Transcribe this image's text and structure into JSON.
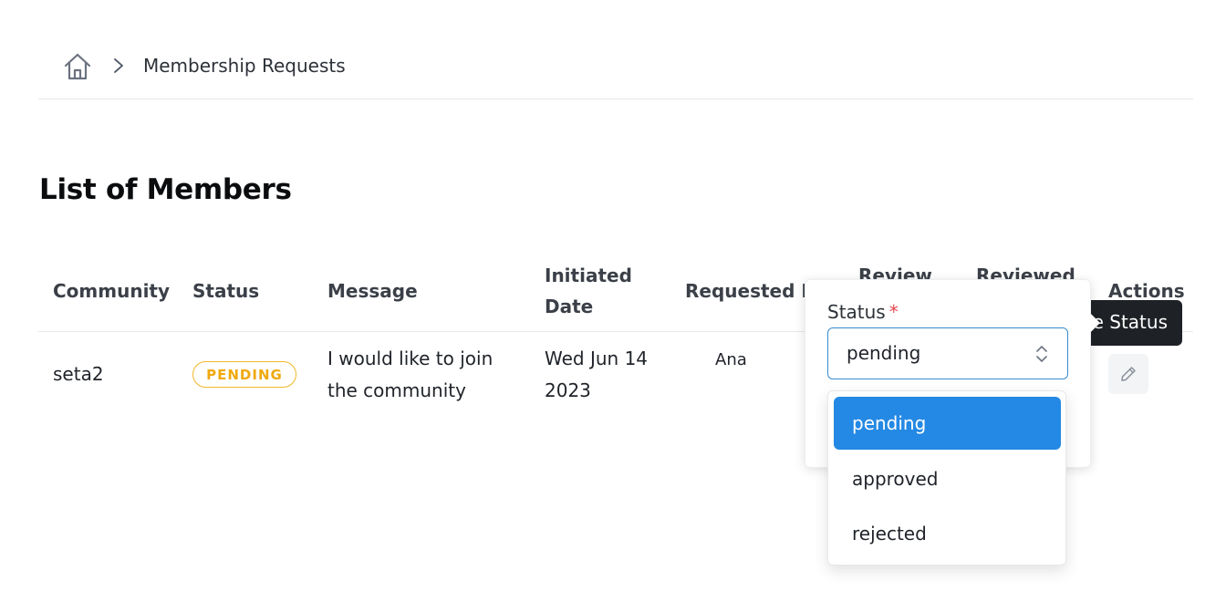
{
  "breadcrumb": {
    "current": "Membership Requests",
    "home_icon": "home-icon",
    "separator_icon": "chevron-right-icon"
  },
  "page_title": "List of Members",
  "table": {
    "columns": {
      "community": "Community",
      "status": "Status",
      "message": "Message",
      "initiated_date_line1": "Initiated",
      "initiated_date_line2": "Date",
      "requested_by": "Requested By",
      "review": "Review",
      "reviewed": "Reviewed",
      "actions": "Actions"
    },
    "rows": [
      {
        "community": "seta2",
        "status": "PENDING",
        "message_line1": "I would like to join",
        "message_line2": "the community",
        "date_line1": "Wed Jun 14",
        "date_line2": "2023",
        "requested_by": "Ana",
        "action_icon": "pencil-icon"
      }
    ]
  },
  "tooltip": {
    "text": "Update Status"
  },
  "status_form": {
    "label": "Status",
    "required_mark": "*",
    "selected": "pending",
    "options": [
      "pending",
      "approved",
      "rejected"
    ]
  },
  "colors": {
    "accent": "#2489e4",
    "pending_badge": "#f0a90d",
    "required": "#e5484d",
    "tooltip_bg": "#1e2126"
  }
}
